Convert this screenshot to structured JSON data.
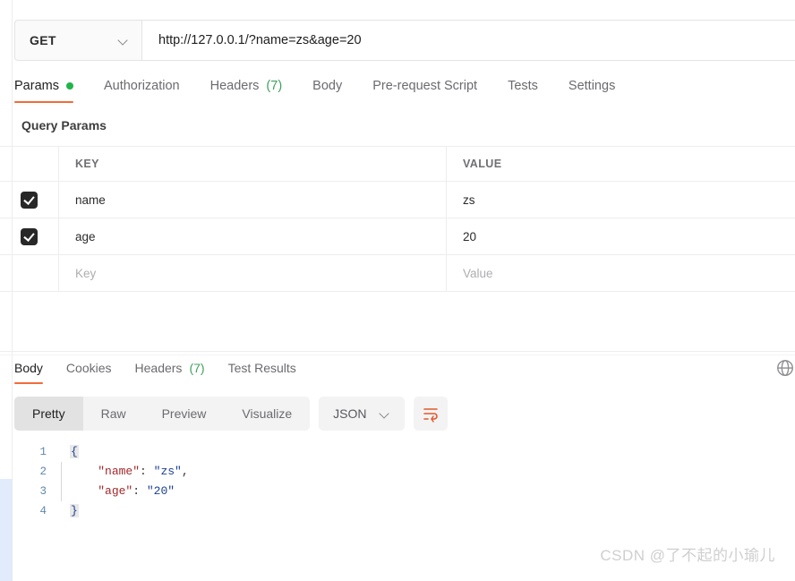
{
  "request": {
    "method": "GET",
    "url": "http://127.0.0.1/?name=zs&age=20",
    "method_icon": "chevron-down-icon",
    "tabs": [
      {
        "label": "Params",
        "badge": "",
        "dot": true,
        "active": true
      },
      {
        "label": "Authorization",
        "badge": "",
        "dot": false,
        "active": false
      },
      {
        "label": "Headers",
        "badge": "(7)",
        "dot": false,
        "active": false
      },
      {
        "label": "Body",
        "badge": "",
        "dot": false,
        "active": false
      },
      {
        "label": "Pre-request Script",
        "badge": "",
        "dot": false,
        "active": false
      },
      {
        "label": "Tests",
        "badge": "",
        "dot": false,
        "active": false
      },
      {
        "label": "Settings",
        "badge": "",
        "dot": false,
        "active": false
      }
    ]
  },
  "query_params": {
    "section_title": "Query Params",
    "columns": {
      "key": "KEY",
      "value": "VALUE"
    },
    "rows": [
      {
        "checked": true,
        "key": "name",
        "value": "zs",
        "placeholder": false
      },
      {
        "checked": true,
        "key": "age",
        "value": "20",
        "placeholder": false
      },
      {
        "checked": false,
        "key": "Key",
        "value": "Value",
        "placeholder": true
      }
    ]
  },
  "response": {
    "tabs": [
      {
        "label": "Body",
        "badge": "",
        "active": true
      },
      {
        "label": "Cookies",
        "badge": "",
        "active": false
      },
      {
        "label": "Headers",
        "badge": "(7)",
        "active": false
      },
      {
        "label": "Test Results",
        "badge": "",
        "active": false
      }
    ],
    "globe_icon": "globe-icon",
    "view_modes": [
      {
        "label": "Pretty",
        "active": true
      },
      {
        "label": "Raw",
        "active": false
      },
      {
        "label": "Preview",
        "active": false
      },
      {
        "label": "Visualize",
        "active": false
      }
    ],
    "language": "JSON",
    "language_icon": "chevron-down-icon",
    "wrap_icon": "wrap-text-icon",
    "code_lines": [
      {
        "n": "1",
        "indent": "",
        "content": "{",
        "type": "brace"
      },
      {
        "n": "2",
        "indent": "    ",
        "key": "\"name\"",
        "sep": ": ",
        "value": "\"zs\"",
        "tail": ",",
        "type": "pair"
      },
      {
        "n": "3",
        "indent": "    ",
        "key": "\"age\"",
        "sep": ": ",
        "value": "\"20\"",
        "tail": "",
        "type": "pair"
      },
      {
        "n": "4",
        "indent": "",
        "content": "}",
        "type": "brace"
      }
    ]
  },
  "watermark": "CSDN @了不起的小瑜儿",
  "colors": {
    "accent": "#f26b3a",
    "green": "#20b549",
    "checkbox": "#282828",
    "json_key": "#a3292b",
    "json_string": "#1c3f94",
    "left_strip": "#e1ebfb"
  }
}
